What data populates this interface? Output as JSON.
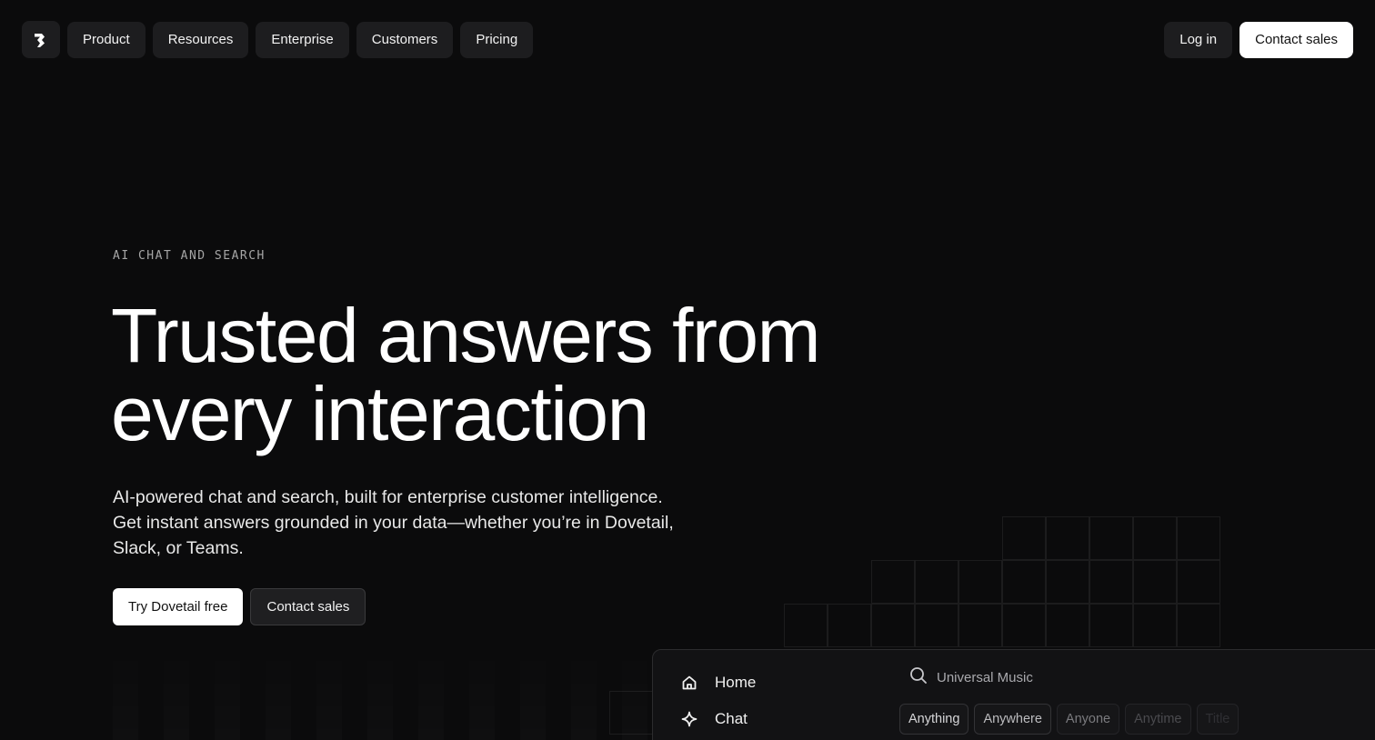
{
  "nav": {
    "logo_icon": "dovetail-logo-icon",
    "items": [
      {
        "label": "Product"
      },
      {
        "label": "Resources"
      },
      {
        "label": "Enterprise"
      },
      {
        "label": "Customers"
      },
      {
        "label": "Pricing"
      }
    ],
    "login_label": "Log in",
    "contact_label": "Contact sales"
  },
  "hero": {
    "eyebrow": "AI CHAT AND SEARCH",
    "headline_line1": "Trusted answers from",
    "headline_line2": "every interaction",
    "subcopy": "AI-powered chat and search, built for enterprise customer intelligence. Get instant answers grounded in your data—whether you’re in Dovetail, Slack, or Teams.",
    "cta_primary": "Try Dovetail free",
    "cta_secondary": "Contact sales"
  },
  "preview": {
    "sidebar": [
      {
        "label": "Home",
        "icon": "home-icon"
      },
      {
        "label": "Chat",
        "icon": "sparkle-icon"
      }
    ],
    "search": {
      "icon": "search-icon",
      "value": "Universal Music"
    },
    "filters": [
      {
        "label": "Anything",
        "color": "#d6d6d8"
      },
      {
        "label": "Anywhere",
        "color": "#bcbcbf"
      },
      {
        "label": "Anyone",
        "color": "#7a7a7e"
      },
      {
        "label": "Anytime",
        "color": "#4a4a4e"
      },
      {
        "label": "Title",
        "color": "#2f2f33"
      }
    ]
  },
  "colors": {
    "background": "#0b0b0c",
    "nav_button": "#1d1d1f",
    "primary_button": "#ffffff"
  }
}
